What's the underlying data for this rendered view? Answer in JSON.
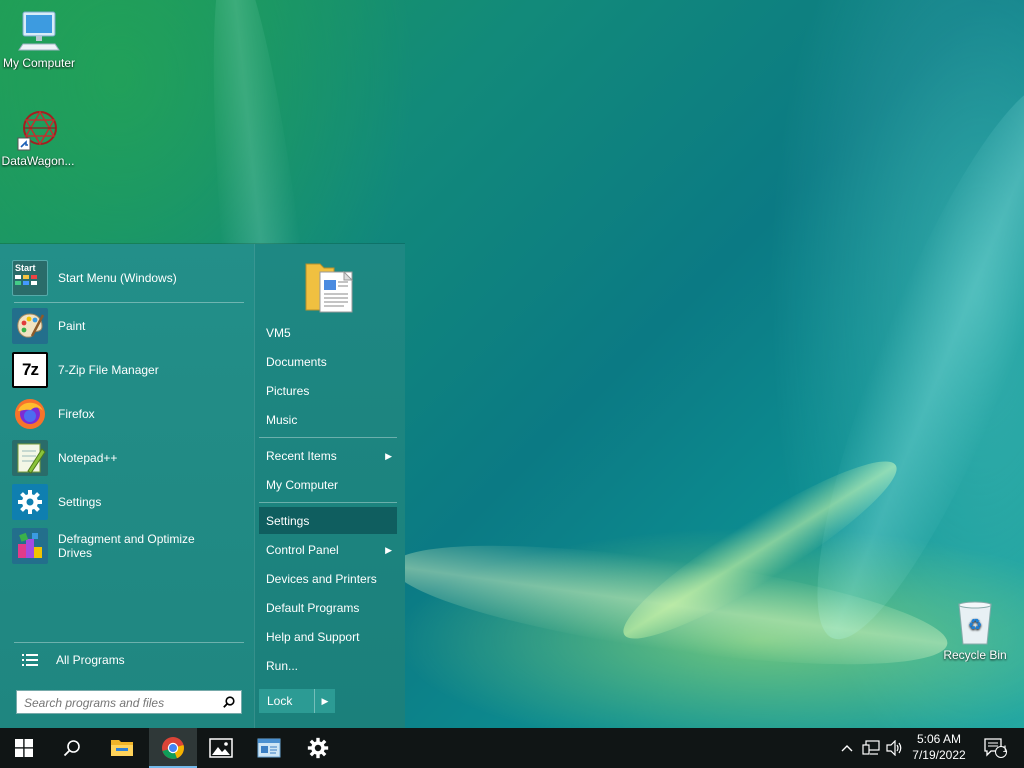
{
  "desktop": {
    "icons": [
      {
        "label": "My Computer"
      },
      {
        "label": "DataWagon..."
      },
      {
        "label": "Recycle Bin"
      }
    ]
  },
  "start_menu": {
    "pinned": [
      {
        "label": "Start Menu (Windows)",
        "icon": "start-menu-icon"
      },
      {
        "label": "Paint",
        "icon": "paint-palette-icon"
      },
      {
        "label": "7-Zip File Manager",
        "icon": "7zip-icon",
        "icon_text": "7z"
      },
      {
        "label": "Firefox",
        "icon": "firefox-icon"
      },
      {
        "label": "Notepad++",
        "icon": "notepad-plus-plus-icon"
      },
      {
        "label": "Settings",
        "icon": "gear-icon"
      },
      {
        "label": "Defragment and Optimize Drives",
        "icon": "defragment-icon"
      }
    ],
    "start_icon_text": "Start",
    "all_programs": "All Programs",
    "search_placeholder": "Search programs and files",
    "right_links": [
      {
        "label": "VM5"
      },
      {
        "label": "Documents"
      },
      {
        "label": "Pictures"
      },
      {
        "label": "Music"
      },
      {
        "label": "Recent Items",
        "submenu": true
      },
      {
        "label": "My Computer"
      },
      {
        "label": "Settings",
        "selected": true
      },
      {
        "label": "Control Panel",
        "submenu": true
      },
      {
        "label": "Devices and Printers"
      },
      {
        "label": "Default Programs"
      },
      {
        "label": "Help and Support"
      },
      {
        "label": "Run..."
      }
    ],
    "lock_label": "Lock"
  },
  "taskbar": {
    "apps": [
      {
        "name": "start-button",
        "icon": "windows-logo-icon"
      },
      {
        "name": "search-button",
        "icon": "search-icon"
      },
      {
        "name": "file-explorer-button",
        "icon": "folder-icon"
      },
      {
        "name": "chrome-button",
        "icon": "chrome-icon",
        "active": true
      },
      {
        "name": "photos-button",
        "icon": "photos-icon"
      },
      {
        "name": "control-panel-button",
        "icon": "control-panel-icon"
      },
      {
        "name": "settings-button",
        "icon": "gear-icon"
      }
    ],
    "clock": {
      "time": "5:06 AM",
      "date": "7/19/2022"
    },
    "notifications_count": "1"
  },
  "colors": {
    "menu_bg": "#1e8b86",
    "selected_bg": "#0f5e5f",
    "taskbar_bg": "#101515",
    "active_indicator": "#74b9ea"
  }
}
